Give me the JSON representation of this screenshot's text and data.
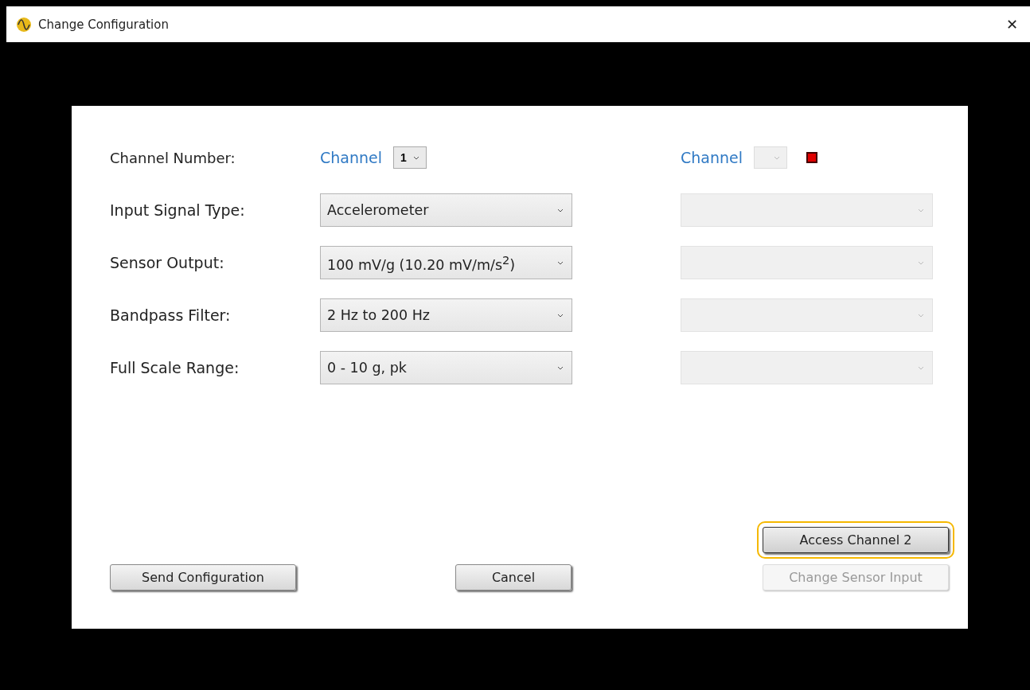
{
  "window": {
    "title": "Change Configuration",
    "close": "✕"
  },
  "channel_row": {
    "label": "Channel Number:",
    "primary": {
      "label": "Channel",
      "value": "1",
      "disabled": false
    },
    "secondary": {
      "label": "Channel",
      "disabled": true,
      "indicator_active": true
    }
  },
  "fields": [
    {
      "label": "Input Signal Type:",
      "value": "Accelerometer",
      "secondary_disabled": true
    },
    {
      "label": "Sensor Output:",
      "value": "100 mV/g (10.20 mV/m/s$^{2}$)",
      "secondary_disabled": true
    },
    {
      "label": "Bandpass Filter:",
      "value": "2 Hz to 200 Hz",
      "secondary_disabled": true
    },
    {
      "label": "Full Scale Range:",
      "value": "0 - 10 g, pk",
      "secondary_disabled": true
    }
  ],
  "buttons": [
    {
      "label": "Send Configuration",
      "kind": "left",
      "disabled": false,
      "focused": false
    },
    {
      "label": "Cancel",
      "kind": "center",
      "disabled": false,
      "focused": false
    },
    {
      "label": "Access Channel 2",
      "kind": "right",
      "disabled": false,
      "focused": true
    },
    {
      "label": "Change Sensor Input",
      "kind": "right",
      "disabled": true,
      "focused": false
    }
  ]
}
